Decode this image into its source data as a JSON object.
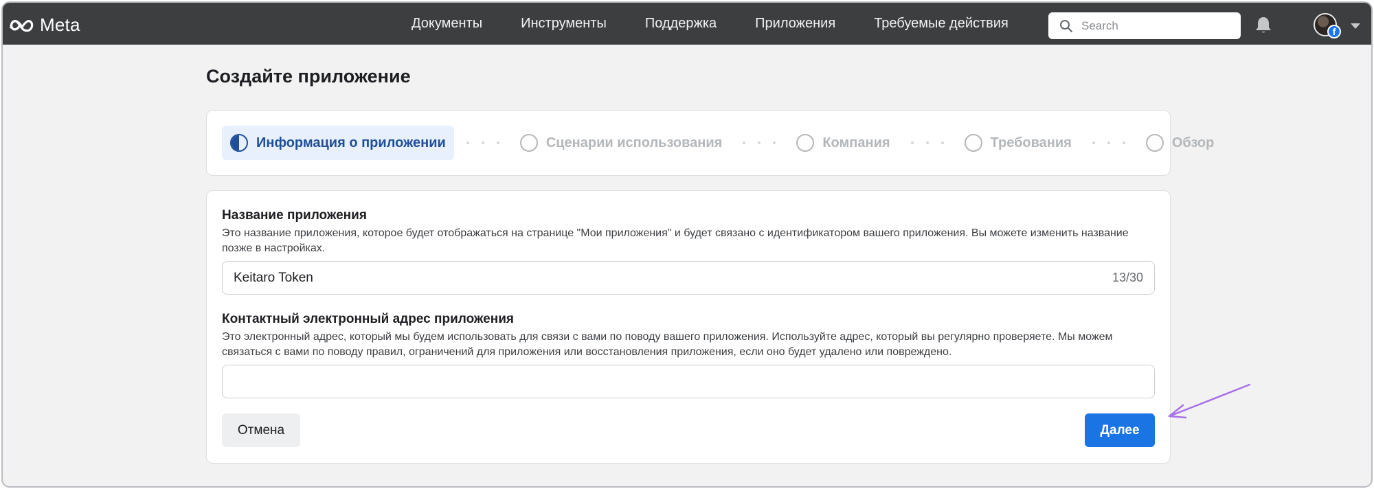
{
  "brand": {
    "name": "Meta"
  },
  "nav": {
    "items": [
      "Документы",
      "Инструменты",
      "Поддержка",
      "Приложения",
      "Требуемые действия"
    ]
  },
  "search": {
    "placeholder": "Search",
    "value": ""
  },
  "page": {
    "title": "Создайте приложение"
  },
  "stepper": {
    "steps": [
      {
        "label": "Информация о приложении",
        "state": "active"
      },
      {
        "label": "Сценарии использования",
        "state": "pending"
      },
      {
        "label": "Компания",
        "state": "pending"
      },
      {
        "label": "Требования",
        "state": "pending"
      },
      {
        "label": "Обзор",
        "state": "pending"
      }
    ]
  },
  "form": {
    "app_name": {
      "label": "Название приложения",
      "description": "Это название приложения, которое будет отображаться на странице \"Мои приложения\" и будет связано с идентификатором вашего приложения. Вы можете изменить название позже в настройках.",
      "value": "Keitaro Token",
      "counter": "13/30"
    },
    "contact_email": {
      "label": "Контактный электронный адрес приложения",
      "description": "Это электронный адрес, который мы будем использовать для связи с вами по поводу вашего приложения. Используйте адрес, который вы регулярно проверяете. Мы можем связаться с вами по поводу правил, ограничений для приложения или восстановления приложения, если оно будет удалено или повреждено.",
      "value": ""
    },
    "cancel_label": "Отмена",
    "next_label": "Далее"
  },
  "colors": {
    "topbar": "#3c3e40",
    "primary": "#1b74e4",
    "active_step": "#1f4f98",
    "annotation_arrow": "#a970e8"
  }
}
